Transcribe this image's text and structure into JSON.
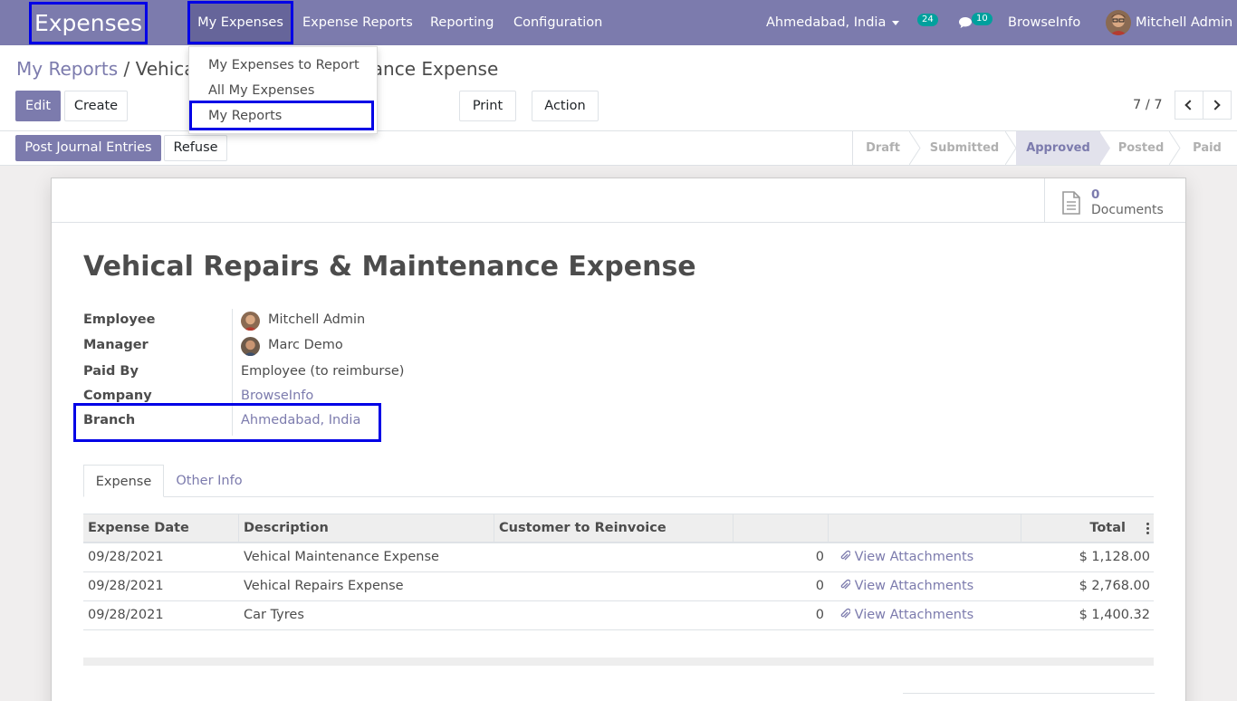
{
  "navbar": {
    "app_name": "Expenses",
    "menus": [
      "My Expenses",
      "Expense Reports",
      "Reporting",
      "Configuration"
    ],
    "branch_switcher": "Ahmedabad, India",
    "activity_count": "24",
    "message_count": "10",
    "company": "BrowseInfo",
    "user": "Mitchell Admin"
  },
  "dropdown": {
    "items": [
      "My Expenses to Report",
      "All My Expenses",
      "My Reports"
    ]
  },
  "breadcrumb": {
    "parent": "My Reports",
    "separator": " / ",
    "current": "Vehical Repairs & Maintenance Expense"
  },
  "buttons": {
    "edit": "Edit",
    "create": "Create",
    "print": "Print",
    "action": "Action",
    "post": "Post Journal Entries",
    "refuse": "Refuse"
  },
  "pager": "7 / 7",
  "stages": [
    "Draft",
    "Submitted",
    "Approved",
    "Posted",
    "Paid"
  ],
  "active_stage": "Approved",
  "documents": {
    "count": "0",
    "label": "Documents"
  },
  "record": {
    "title": "Vehical Repairs & Maintenance Expense",
    "fields": [
      {
        "label": "Employee",
        "value": "Mitchell Admin"
      },
      {
        "label": "Manager",
        "value": "Marc Demo"
      },
      {
        "label": "Paid By",
        "value": "Employee (to reimburse)"
      },
      {
        "label": "Company",
        "value": "BrowseInfo"
      },
      {
        "label": "Branch",
        "value": "Ahmedabad, India"
      }
    ]
  },
  "tabs": [
    "Expense",
    "Other Info"
  ],
  "table": {
    "headers": [
      "Expense Date",
      "Description",
      "Customer to Reinvoice",
      "",
      "",
      "Total"
    ],
    "rows": [
      {
        "date": "09/28/2021",
        "description": "Vehical Maintenance Expense",
        "qty": "0",
        "attach": "View Attachments",
        "total": "$ 1,128.00"
      },
      {
        "date": "09/28/2021",
        "description": "Vehical Repairs Expense",
        "qty": "0",
        "attach": "View Attachments",
        "total": "$ 2,768.00"
      },
      {
        "date": "09/28/2021",
        "description": "Car Tyres",
        "qty": "0",
        "attach": "View Attachments",
        "total": "$ 1,400.32"
      }
    ]
  },
  "colors": {
    "primary": "#7c7bad",
    "highlight": "#0000e6",
    "badge": "#00a09d"
  }
}
